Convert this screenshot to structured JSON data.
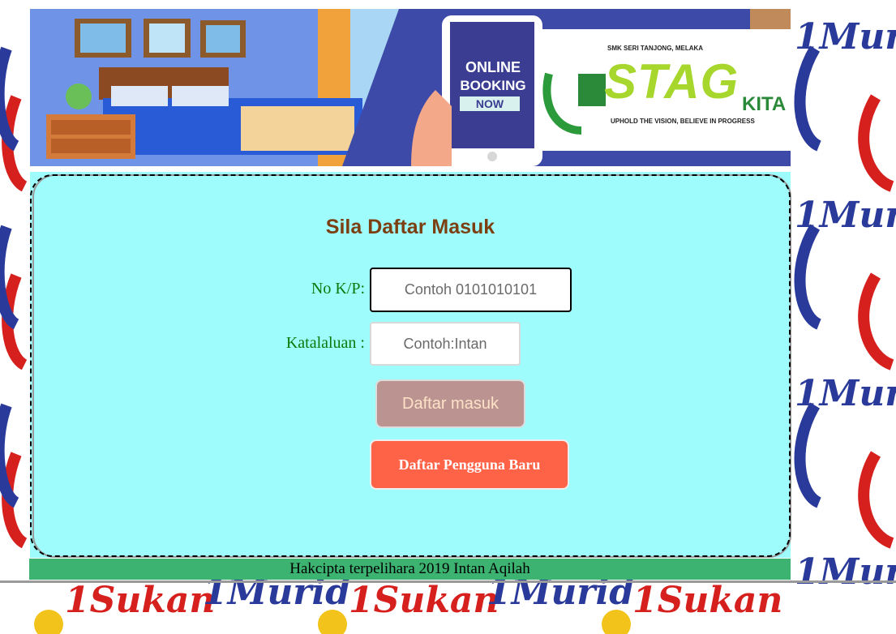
{
  "banner": {
    "booking_line1": "ONLINE",
    "booking_line2": "BOOKING",
    "booking_line3": "NOW",
    "school_name": "SMK SERI TANJONG, MELAKA",
    "logo_word": "STAG",
    "logo_suffix": "KITA",
    "tagline": "UPHOLD THE VISION, BELIEVE IN PROGRESS"
  },
  "login": {
    "title": "Sila Daftar Masuk",
    "ic_label": "No K/P:",
    "ic_placeholder": "Contoh 0101010101",
    "password_label": "Katalaluan :",
    "password_placeholder": "Contoh:Intan",
    "login_button": "Daftar masuk",
    "register_button": "Daftar Pengguna Baru"
  },
  "footer": {
    "copyright": "Hakcipta terpelihara 2019 Intan Aqilah"
  },
  "background": {
    "watermark_text": "1Murid",
    "watermark_text2": "1Sukan"
  },
  "colors": {
    "panel_bg": "#9ffcfd",
    "title": "#7b3f12",
    "label": "#0a7a0a",
    "login_button": "#bb9390",
    "register_button": "#ff6347",
    "footer_bg": "#3cb371"
  }
}
